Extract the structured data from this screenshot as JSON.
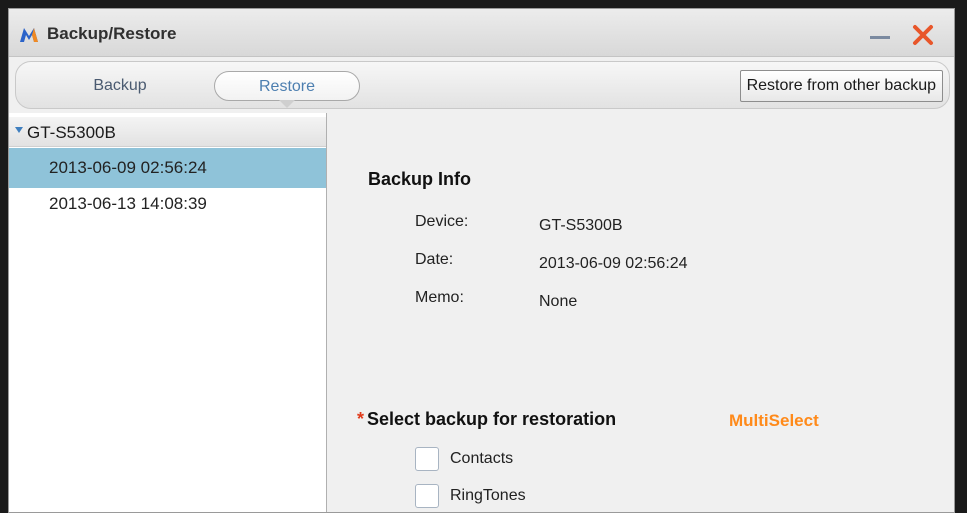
{
  "window": {
    "title": "Backup/Restore",
    "accent_color": "#e8562a"
  },
  "tabs": [
    {
      "label": "Backup",
      "active": false
    },
    {
      "label": "Restore",
      "active": true
    }
  ],
  "toolbar": {
    "restore_other_label": "Restore from other backup"
  },
  "sidebar": {
    "device": "GT-S5300B",
    "backups": [
      {
        "label": "2013-06-09 02:56:24",
        "selected": true
      },
      {
        "label": "2013-06-13 14:08:39",
        "selected": false
      }
    ],
    "selected_color": "#8fc3d9"
  },
  "info": {
    "title": "Backup Info",
    "rows": [
      {
        "label": "Device:",
        "value": "GT-S5300B"
      },
      {
        "label": "Date:",
        "value": "2013-06-09 02:56:24"
      },
      {
        "label": "Memo:",
        "value": "None"
      }
    ]
  },
  "restore": {
    "required_mark": "*",
    "title": "Select backup for restoration",
    "multiselect_label": "MultiSelect",
    "multiselect_color": "#ff8a1a",
    "items": [
      {
        "label": "Contacts",
        "checked": false
      },
      {
        "label": "RingTones",
        "checked": false
      }
    ]
  },
  "icons": {
    "logo": "app-logo-icon",
    "minimize": "minimize-icon",
    "close": "close-icon",
    "tree": "tree-expanded-arrow-icon"
  }
}
